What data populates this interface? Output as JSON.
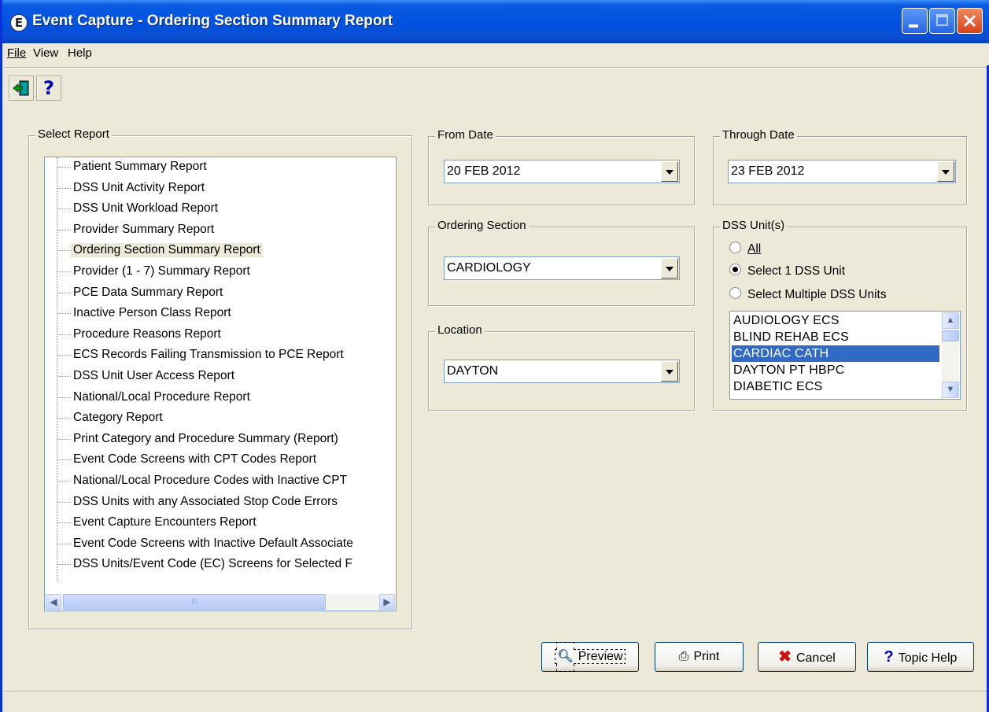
{
  "window": {
    "title": "Event Capture - Ordering Section Summary Report",
    "app_icon": "event-capture-icon"
  },
  "menu": {
    "file": "File",
    "view": "View",
    "help": "Help"
  },
  "toolbar": {
    "exit_icon": "exit-door-icon",
    "help_icon": "question-mark-icon",
    "help_glyph": "?"
  },
  "select_report": {
    "label": "Select Report",
    "items": [
      "Patient Summary Report",
      "DSS Unit Activity Report",
      "DSS Unit Workload Report",
      "Provider Summary Report",
      "Ordering Section Summary Report",
      "Provider (1 - 7) Summary Report",
      "PCE Data Summary Report",
      "Inactive Person Class Report",
      "Procedure Reasons Report",
      "ECS Records Failing Transmission to PCE Report",
      "DSS Unit User Access Report",
      "National/Local Procedure Report",
      "Category Report",
      "Print Category and Procedure Summary (Report)",
      "Event Code Screens with CPT Codes Report",
      "National/Local Procedure Codes with Inactive CPT",
      "DSS Units with any Associated Stop Code Errors",
      "Event Capture Encounters Report",
      "Event Code Screens with Inactive Default Associate",
      "DSS Units/Event Code (EC) Screens for Selected F"
    ],
    "selected_index": 4,
    "scroll_glyph": "III"
  },
  "from_date": {
    "label": "From Date",
    "value": "20 FEB 2012"
  },
  "through_date": {
    "label": "Through Date",
    "value": "23 FEB 2012"
  },
  "ordering_section": {
    "label": "Ordering Section",
    "value": "CARDIOLOGY"
  },
  "location": {
    "label": "Location",
    "value": "DAYTON"
  },
  "dss_units": {
    "label": "DSS Unit(s)",
    "radio_all": "All",
    "radio_single": "Select 1 DSS Unit",
    "radio_multiple": "Select Multiple DSS Units",
    "selected_radio": "single",
    "list": [
      "AUDIOLOGY ECS",
      "BLIND REHAB ECS",
      "CARDIAC CATH",
      "DAYTON PT HBPC",
      "DIABETIC ECS"
    ],
    "selected_index": 2
  },
  "buttons": {
    "preview": "Preview",
    "print": "Print",
    "cancel": "Cancel",
    "topic_help": "Topic Help"
  },
  "colors": {
    "titlebar": "#0053e2",
    "selection": "#316ac5",
    "background": "#ece9d8"
  }
}
